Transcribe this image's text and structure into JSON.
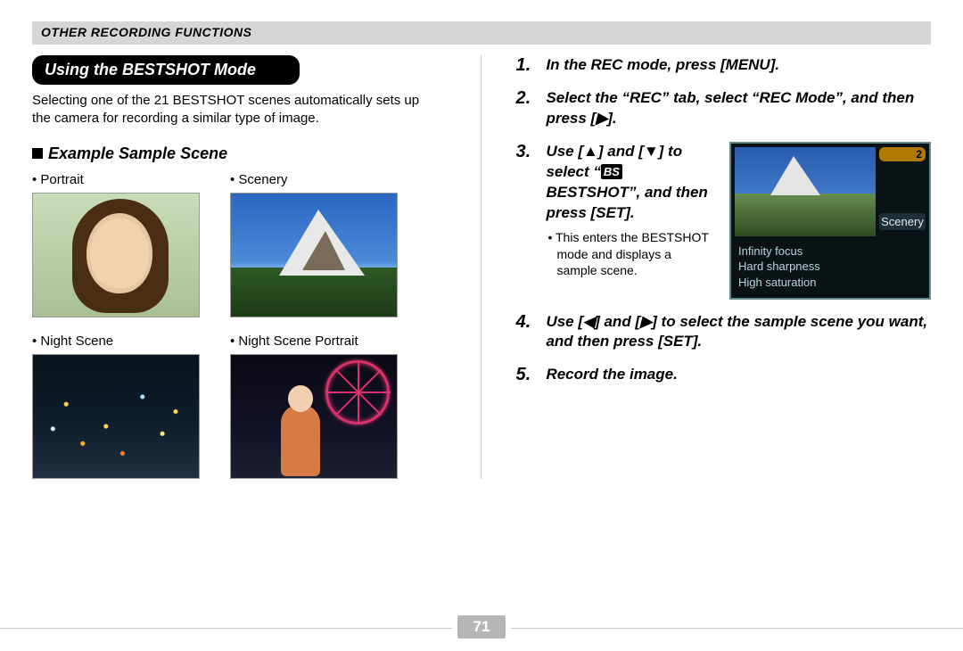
{
  "header": {
    "section": "OTHER RECORDING FUNCTIONS"
  },
  "left": {
    "title": "Using the BESTSHOT Mode",
    "intro": "Selecting one of the 21 BESTSHOT scenes automatically sets up the camera for recording a similar type of image.",
    "sample_heading": "Example Sample Scene",
    "scenes": [
      {
        "label": "Portrait"
      },
      {
        "label": "Scenery"
      },
      {
        "label": "Night Scene"
      },
      {
        "label": "Night Scene Portrait"
      }
    ]
  },
  "right": {
    "steps": {
      "s1": {
        "n": "1.",
        "text": "In the REC mode, press [MENU]."
      },
      "s2": {
        "n": "2.",
        "text": "Select the “REC” tab, select “REC Mode”, and then press [▶]."
      },
      "s3": {
        "n": "3.",
        "text_a": "Use [▲] and [▼] to select “",
        "bs": "BS",
        "text_b": " BESTSHOT”, and then press [SET].",
        "sub": "• This enters the BESTSHOT mode and displays a sample scene."
      },
      "s4": {
        "n": "4.",
        "text": "Use [◀] and [▶] to select the sample scene you want, and then press [SET]."
      },
      "s5": {
        "n": "5.",
        "text": "Record the image."
      }
    },
    "lcd": {
      "badge": "2",
      "label": "Scenery",
      "line1": "Infinity focus",
      "line2": "Hard sharpness",
      "line3": "High saturation"
    }
  },
  "page_number": "71"
}
